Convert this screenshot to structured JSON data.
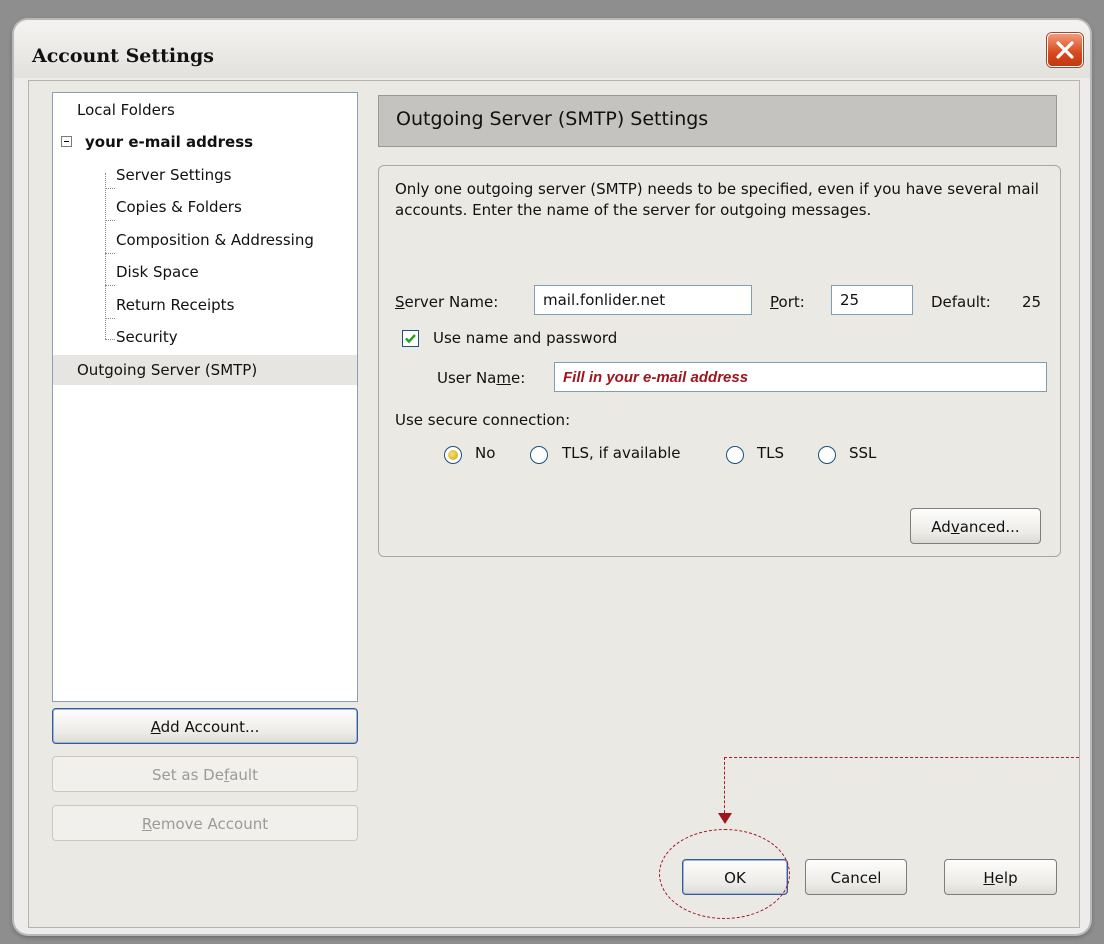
{
  "window": {
    "title": "Account Settings"
  },
  "tree": {
    "items": [
      {
        "label": "Local Folders"
      },
      {
        "label": "your e-mail address"
      },
      {
        "label": "Server Settings"
      },
      {
        "label": "Copies & Folders"
      },
      {
        "label": "Composition & Addressing"
      },
      {
        "label": "Disk Space"
      },
      {
        "label": "Return Receipts"
      },
      {
        "label": "Security"
      },
      {
        "label": "Outgoing Server (SMTP)"
      }
    ]
  },
  "account_buttons": {
    "add": {
      "before": "",
      "mnemonic": "A",
      "after": "dd Account..."
    },
    "set_default": {
      "before": "Set as De",
      "mnemonic": "f",
      "after": "ault"
    },
    "remove": {
      "before": "",
      "mnemonic": "R",
      "after": "emove Account"
    }
  },
  "panel": {
    "header": "Outgoing Server (SMTP) Settings",
    "description": "Only one outgoing server (SMTP) needs to be specified, even if you have several mail accounts. Enter the name of the server for outgoing messages.",
    "server_name": {
      "label_mnemonic": "S",
      "label_rest": "erver Name:",
      "value": "mail.fonlider.net"
    },
    "port": {
      "label_mnemonic": "P",
      "label_rest": "ort:",
      "value": "25"
    },
    "default": {
      "label": "Default:",
      "value": "25"
    },
    "use_auth": {
      "label": "Use name and password",
      "checked": true
    },
    "user_name": {
      "label_before": "User Na",
      "label_mnemonic": "m",
      "label_after": "e:",
      "value": "Fill in your e-mail address"
    },
    "secure": {
      "label": "Use secure connection:",
      "options": [
        {
          "label": "No",
          "selected": true
        },
        {
          "label": "TLS, if available",
          "selected": false
        },
        {
          "label": "TLS",
          "selected": false
        },
        {
          "label": "SSL",
          "selected": false
        }
      ]
    },
    "advanced": {
      "before": "Ad",
      "mnemonic": "v",
      "after": "anced..."
    }
  },
  "dialog_buttons": {
    "ok": "OK",
    "cancel": "Cancel",
    "help": {
      "mnemonic": "H",
      "after": "elp"
    }
  },
  "colors": {
    "annotation": "#a0141c",
    "accent": "#3a5a94"
  }
}
